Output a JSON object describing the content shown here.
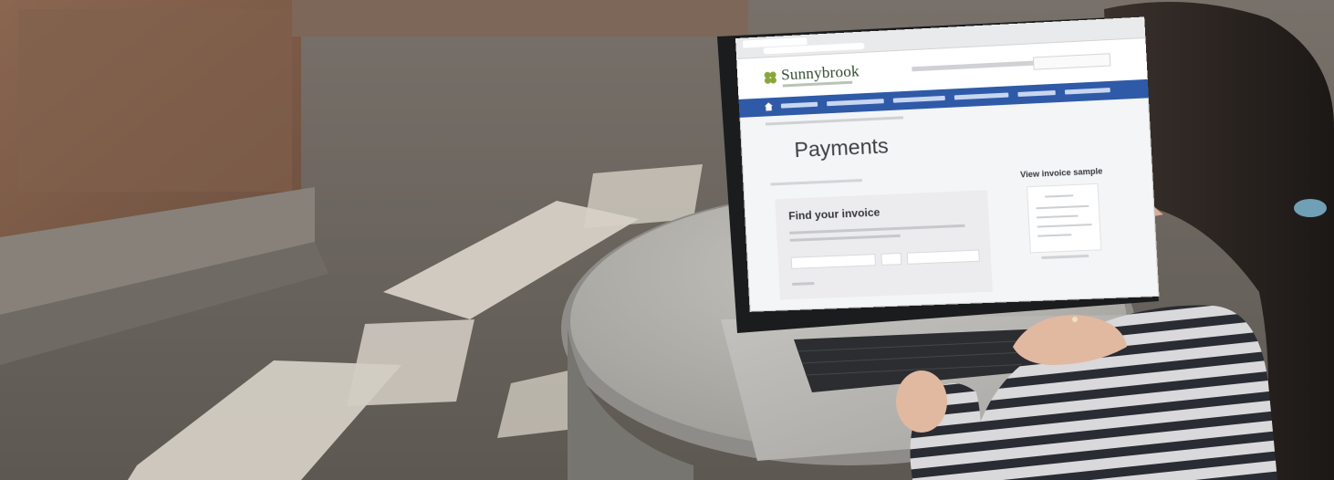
{
  "scene": {
    "description_colors": {
      "wall": "#7a5c48",
      "floor": "#6b655e",
      "light": "#c9c3b9",
      "table": "#b2b0ab",
      "laptop": "#b7b5b1",
      "keys": "#2c2d30",
      "hair": "#2b2522",
      "shirt_dark": "#2a2c33",
      "shirt_light": "#d9d8da",
      "skin": "#e1b9a0"
    }
  },
  "website": {
    "brand": "Sunnybrook",
    "page_title": "Payments",
    "find_invoice_title": "Find your invoice",
    "view_invoice_sample": "View invoice sample",
    "nav_color": "#2f5aa8",
    "brand_color": "#2f4a2c",
    "logo_color": "#8aa63b"
  }
}
